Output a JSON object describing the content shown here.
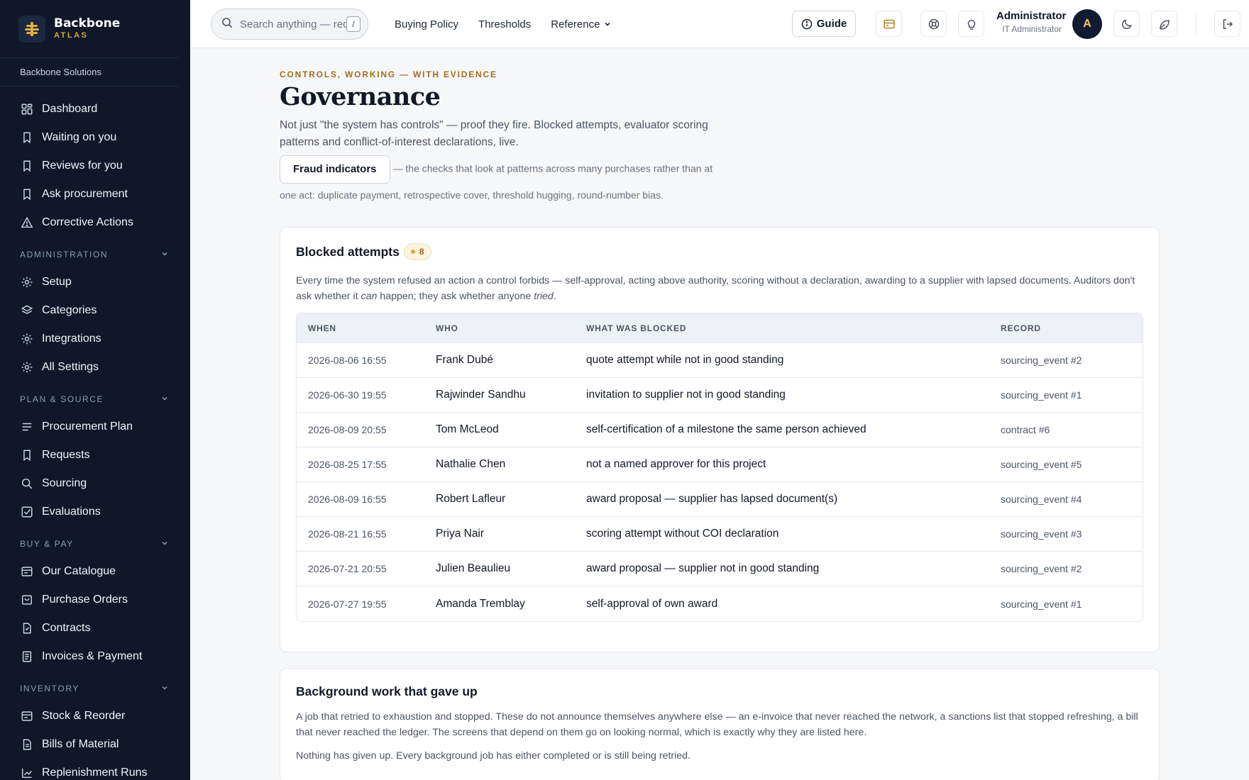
{
  "brand": {
    "name": "Backbone",
    "product": "ATLAS",
    "org": "Backbone Solutions"
  },
  "sidebar": {
    "top": [
      {
        "label": "Dashboard",
        "icon": "dashboard-icon"
      },
      {
        "label": "Waiting on you",
        "icon": "bookmark-icon"
      },
      {
        "label": "Reviews for you",
        "icon": "bookmark-icon"
      },
      {
        "label": "Ask procurement",
        "icon": "bookmark-icon"
      },
      {
        "label": "Corrective Actions",
        "icon": "warning-icon"
      }
    ],
    "sections": [
      {
        "title": "ADMINISTRATION",
        "items": [
          {
            "label": "Setup",
            "icon": "gear-icon"
          },
          {
            "label": "Categories",
            "icon": "layers-icon"
          },
          {
            "label": "Integrations",
            "icon": "gear-icon"
          },
          {
            "label": "All Settings",
            "icon": "gear-icon"
          }
        ]
      },
      {
        "title": "PLAN & SOURCE",
        "items": [
          {
            "label": "Procurement Plan",
            "icon": "list-icon"
          },
          {
            "label": "Requests",
            "icon": "bookmark-icon"
          },
          {
            "label": "Sourcing",
            "icon": "search-icon"
          },
          {
            "label": "Evaluations",
            "icon": "check-square-icon"
          }
        ]
      },
      {
        "title": "BUY & PAY",
        "items": [
          {
            "label": "Our Catalogue",
            "icon": "catalogue-icon"
          },
          {
            "label": "Purchase Orders",
            "icon": "bag-icon"
          },
          {
            "label": "Contracts",
            "icon": "file-icon"
          },
          {
            "label": "Invoices & Payment",
            "icon": "receipt-icon"
          }
        ]
      },
      {
        "title": "INVENTORY",
        "items": [
          {
            "label": "Stock & Reorder",
            "icon": "catalogue-icon"
          },
          {
            "label": "Bills of Material",
            "icon": "file-icon"
          },
          {
            "label": "Replenishment Runs",
            "icon": "chart-icon"
          }
        ]
      }
    ]
  },
  "topbar": {
    "search_placeholder": "Search anything — requests, suppliers, POs",
    "search_shortcut": "/",
    "nav": [
      "Buying Policy",
      "Thresholds",
      "Reference"
    ],
    "guide_label": "Guide",
    "user_name": "Administrator",
    "user_role": "IT Administrator",
    "avatar_initial": "A"
  },
  "page": {
    "eyebrow": "CONTROLS, WORKING — WITH EVIDENCE",
    "title": "Governance",
    "subtitle": "Not just \"the system has controls\" — proof they fire. Blocked attempts, evaluator scoring patterns and conflict-of-interest declarations, live.",
    "fraud_button": "Fraud indicators",
    "fraud_text": "— the checks that look at patterns across many purchases rather than at one act: duplicate payment, retrospective cover, threshold hugging, round-number bias."
  },
  "blocked": {
    "title": "Blocked attempts",
    "count": "8",
    "desc_a": "Every time the system refused an action a control forbids — self-approval, acting above authority, scoring without a declaration, awarding to a supplier with lapsed documents. Auditors don't ask whether it ",
    "desc_can": "can",
    "desc_b": " happen; they ask whether anyone ",
    "desc_tried": "tried",
    "desc_c": ".",
    "columns": [
      "WHEN",
      "WHO",
      "WHAT WAS BLOCKED",
      "RECORD"
    ],
    "rows": [
      {
        "when": "2026-08-06 16:55",
        "who": "Frank Dubé",
        "what": "quote attempt while not in good standing",
        "record": "sourcing_event #2"
      },
      {
        "when": "2026-06-30 19:55",
        "who": "Rajwinder Sandhu",
        "what": "invitation to supplier not in good standing",
        "record": "sourcing_event #1"
      },
      {
        "when": "2026-08-09 20:55",
        "who": "Tom McLeod",
        "what": "self-certification of a milestone the same person achieved",
        "record": "contract #6"
      },
      {
        "when": "2026-08-25 17:55",
        "who": "Nathalie Chen",
        "what": "not a named approver for this project",
        "record": "sourcing_event #5"
      },
      {
        "when": "2026-08-09 16:55",
        "who": "Robert Lafleur",
        "what": "award proposal — supplier has lapsed document(s)",
        "record": "sourcing_event #4"
      },
      {
        "when": "2026-08-21 16:55",
        "who": "Priya Nair",
        "what": "scoring attempt without COI declaration",
        "record": "sourcing_event #3"
      },
      {
        "when": "2026-07-21 20:55",
        "who": "Julien Beaulieu",
        "what": "award proposal — supplier not in good standing",
        "record": "sourcing_event #2"
      },
      {
        "when": "2026-07-27 19:55",
        "who": "Amanda Tremblay",
        "what": "self-approval of own award",
        "record": "sourcing_event #1"
      }
    ]
  },
  "background": {
    "title": "Background work that gave up",
    "desc": "A job that retried to exhaustion and stopped. These do not announce themselves anywhere else — an e-invoice that never reached the network, a sanctions list that stopped refreshing, a bill that never reached the ledger. The screens that depend on them go on looking normal, which is exactly why they are listed here.",
    "note": "Nothing has given up. Every background job has either completed or is still being retried."
  }
}
